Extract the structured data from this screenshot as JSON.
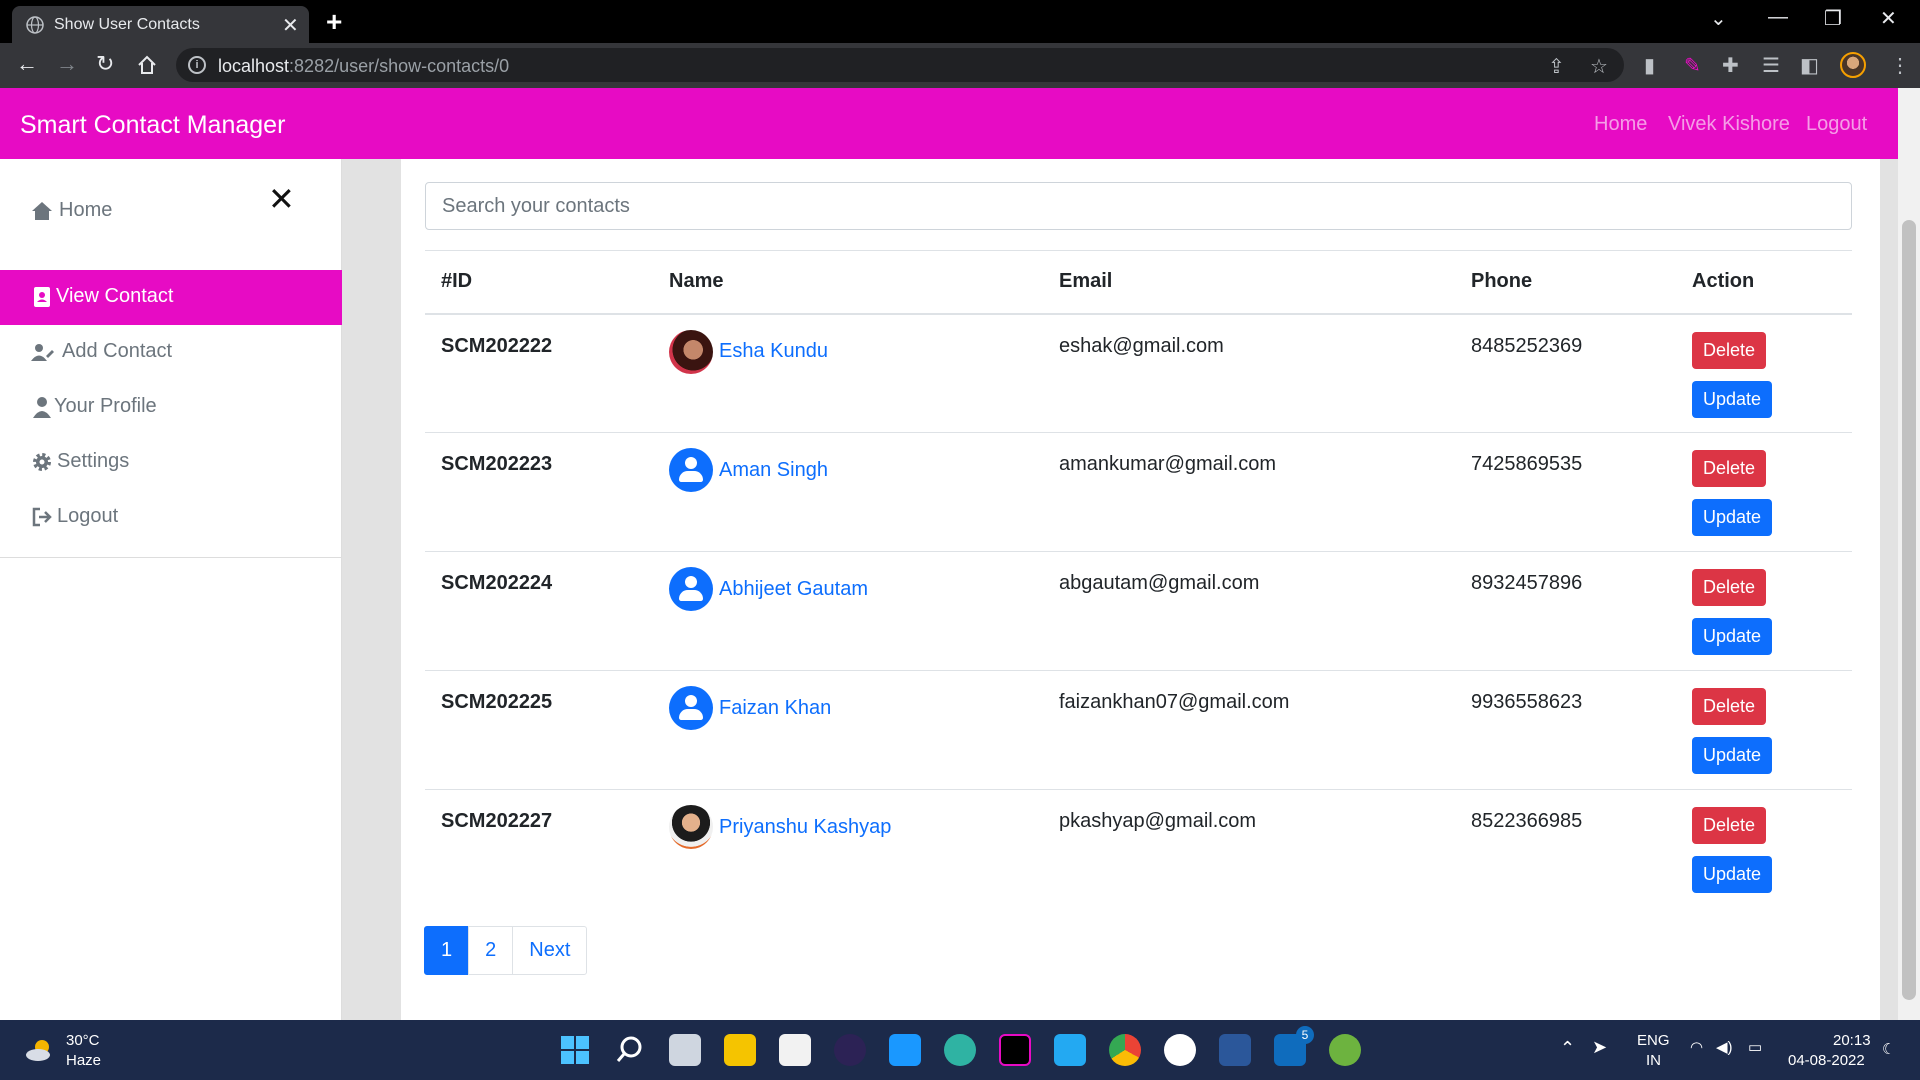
{
  "browser": {
    "tab_title": "Show User Contacts",
    "tab_close": "✕",
    "new_tab": "+",
    "url_host": "localhost",
    "url_path": ":8282/user/show-contacts/0"
  },
  "navbar": {
    "brand": "Smart Contact Manager",
    "links": [
      "Home",
      "Vivek Kishore",
      "Logout"
    ]
  },
  "sidebar": {
    "close": "✕",
    "items": [
      {
        "label": "Home",
        "icon": "home-icon"
      },
      {
        "label": "View Contact",
        "icon": "contact-card-icon",
        "active": true
      },
      {
        "label": "Add Contact",
        "icon": "user-pen-icon"
      },
      {
        "label": "Your Profile",
        "icon": "user-icon"
      },
      {
        "label": "Settings",
        "icon": "gear-icon"
      },
      {
        "label": "Logout",
        "icon": "logout-icon"
      }
    ]
  },
  "search": {
    "placeholder": "Search your contacts"
  },
  "table": {
    "headers": [
      "#ID",
      "Name",
      "Email",
      "Phone",
      "Action"
    ],
    "rows": [
      {
        "id": "SCM202222",
        "name": "Esha Kundu",
        "email": "eshak@gmail.com",
        "phone": "8485252369",
        "avatar": "photo"
      },
      {
        "id": "SCM202223",
        "name": "Aman Singh",
        "email": "amankumar@gmail.com",
        "phone": "7425869535",
        "avatar": "default"
      },
      {
        "id": "SCM202224",
        "name": "Abhijeet Gautam",
        "email": "abgautam@gmail.com",
        "phone": "8932457896",
        "avatar": "default"
      },
      {
        "id": "SCM202225",
        "name": "Faizan Khan",
        "email": "faizankhan07@gmail.com",
        "phone": "9936558623",
        "avatar": "default"
      },
      {
        "id": "SCM202227",
        "name": "Priyanshu Kashyap",
        "email": "pkashyap@gmail.com",
        "phone": "8522366985",
        "avatar": "photo"
      }
    ],
    "delete_label": "Delete",
    "update_label": "Update"
  },
  "pagination": {
    "pages": [
      "1",
      "2"
    ],
    "next": "Next",
    "current": "1"
  },
  "taskbar": {
    "temperature": "30°C",
    "weather": "Haze",
    "lang": "ENG",
    "region": "IN",
    "time": "20:13",
    "date": "04-08-2022",
    "mail_badge": "5"
  },
  "colors": {
    "brand": "#e70bc4",
    "primary": "#0d6efd",
    "danger": "#dc3545"
  }
}
